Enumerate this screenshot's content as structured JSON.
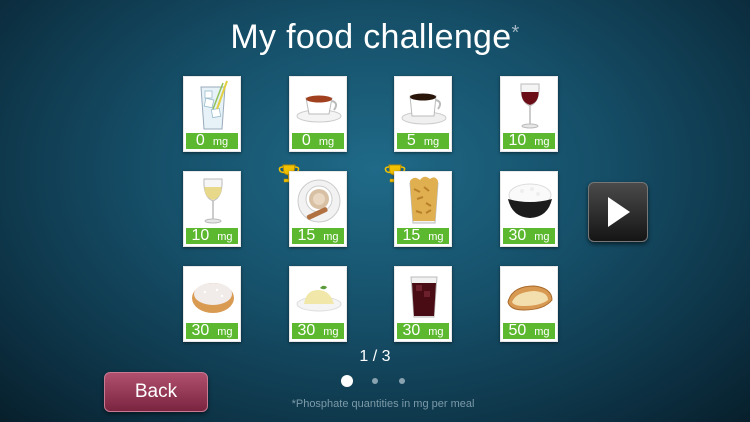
{
  "title": "My food challenge",
  "title_asterisk": "*",
  "foods": [
    {
      "name": "water",
      "value": "0",
      "unit": "mg"
    },
    {
      "name": "tea",
      "value": "0",
      "unit": "mg"
    },
    {
      "name": "coffee",
      "value": "5",
      "unit": "mg"
    },
    {
      "name": "red-wine",
      "value": "10",
      "unit": "mg"
    },
    {
      "name": "white-wine",
      "value": "10",
      "unit": "mg",
      "trophy": false
    },
    {
      "name": "cappuccino",
      "value": "15",
      "unit": "mg",
      "trophy": true
    },
    {
      "name": "cornflakes",
      "value": "15",
      "unit": "mg",
      "trophy": true
    },
    {
      "name": "rice",
      "value": "30",
      "unit": "mg"
    },
    {
      "name": "donut",
      "value": "30",
      "unit": "mg"
    },
    {
      "name": "mashed-potatoes",
      "value": "30",
      "unit": "mg"
    },
    {
      "name": "cola",
      "value": "30",
      "unit": "mg"
    },
    {
      "name": "bread",
      "value": "50",
      "unit": "mg"
    }
  ],
  "pagination": {
    "text": "1 / 3",
    "current": 1,
    "total": 3
  },
  "back_label": "Back",
  "footnote": "*Phosphate quantities in mg per meal",
  "colors": {
    "accent_green": "#5cb82f",
    "back_button": "#9a3a5a",
    "trophy": "#f2c200"
  }
}
